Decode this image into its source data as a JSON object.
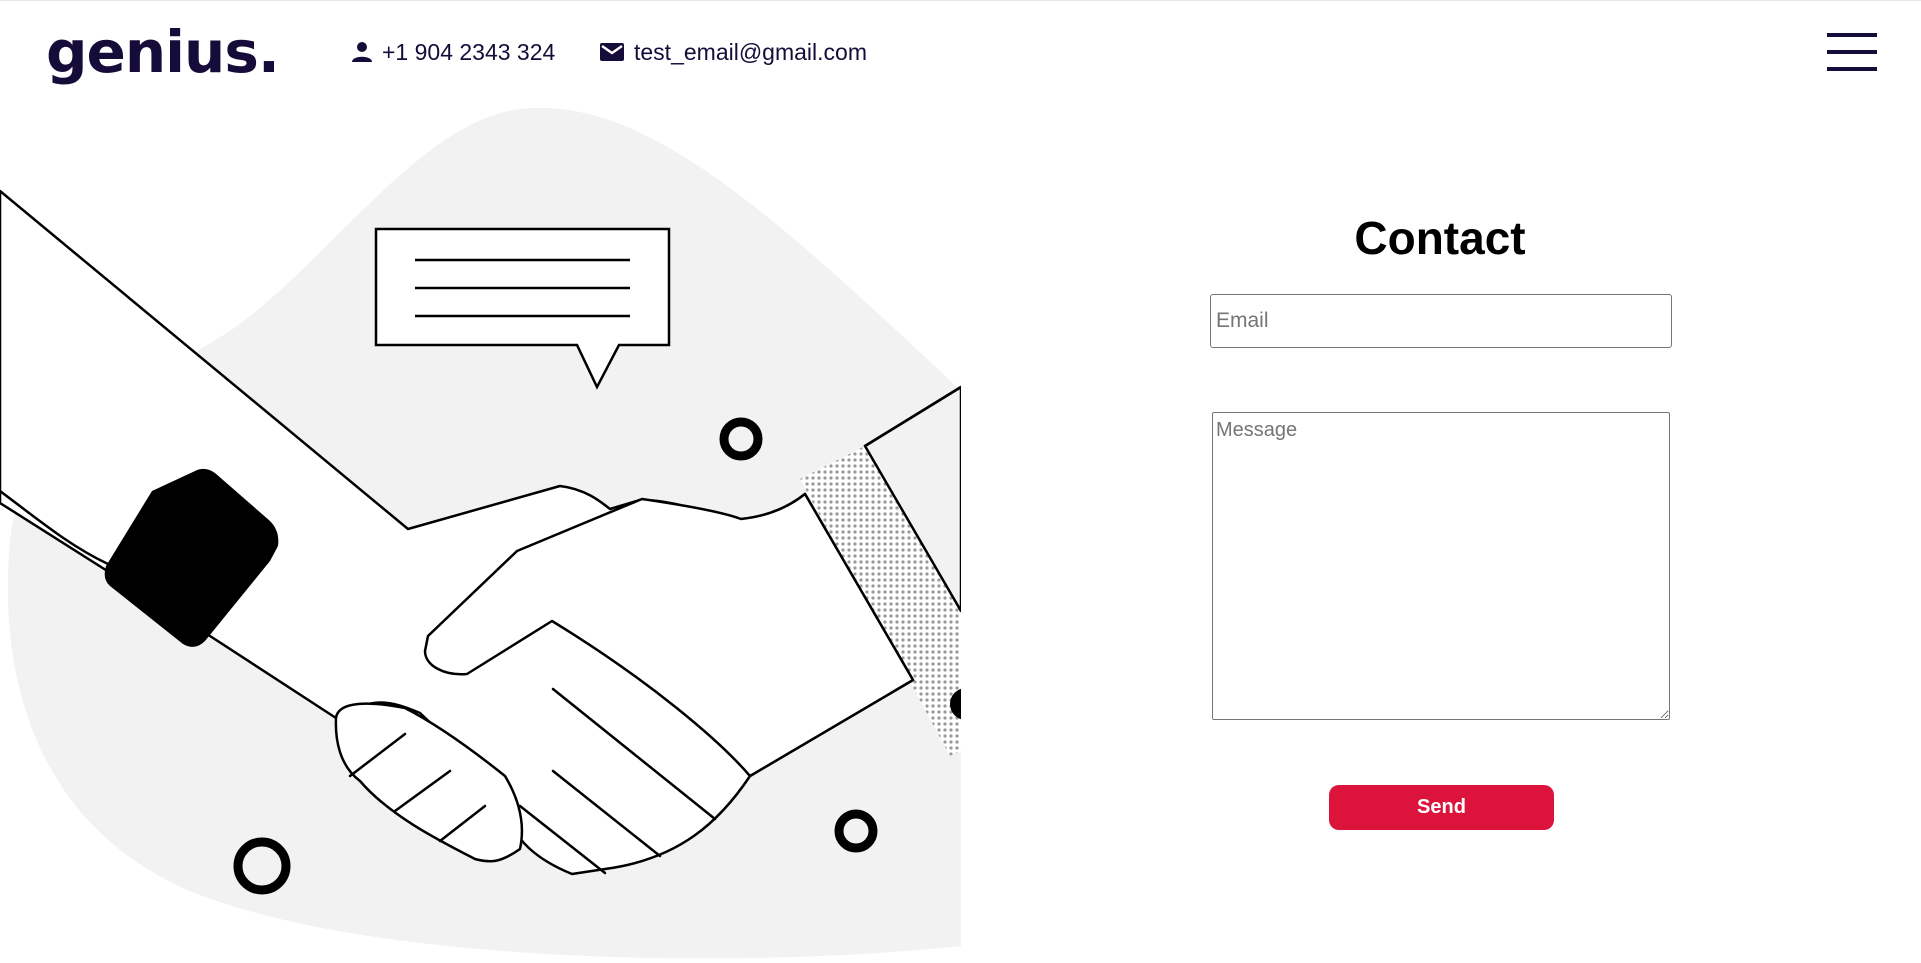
{
  "header": {
    "logo": "genius.",
    "phone": "+1 904 2343 324",
    "email": "test_email@gmail.com",
    "icons": {
      "phone": "person-icon",
      "email": "envelope-icon",
      "menu": "hamburger-menu-icon"
    }
  },
  "contact": {
    "title": "Contact",
    "email_placeholder": "Email",
    "message_placeholder": "Message",
    "send_label": "Send"
  },
  "colors": {
    "brand": "#160c3a",
    "accent": "#dc143c",
    "blob": "#f2f2f2"
  }
}
